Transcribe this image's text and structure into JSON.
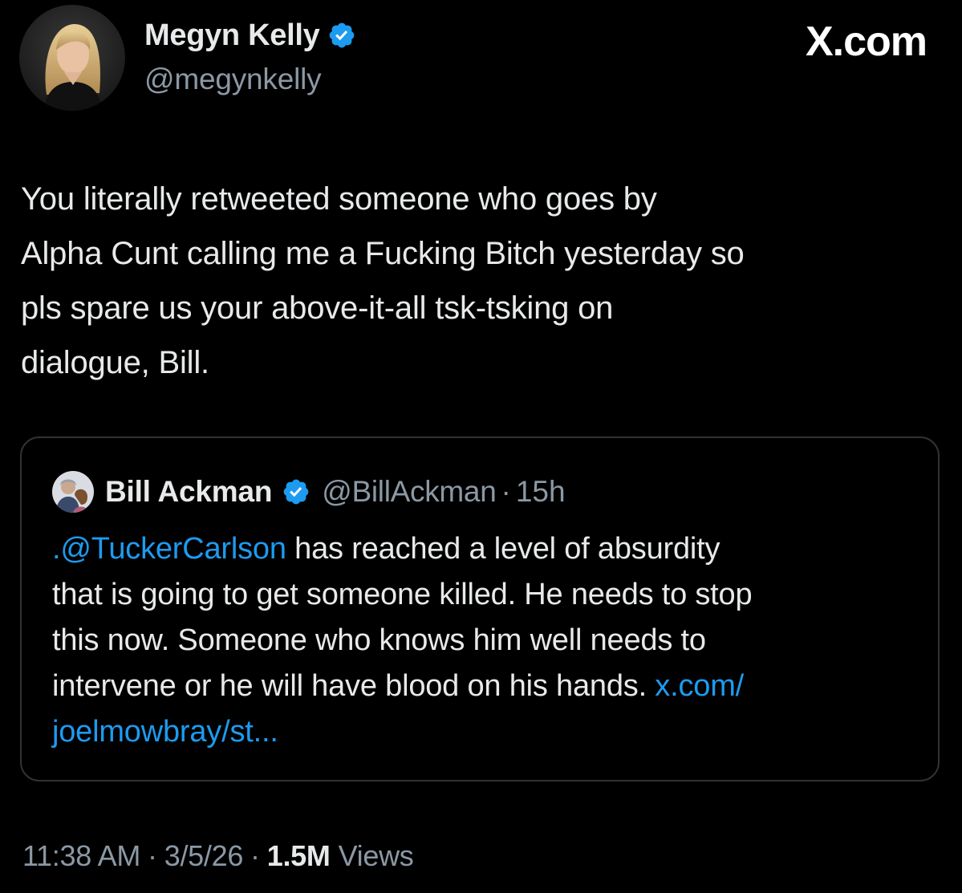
{
  "author": {
    "name": "Megyn Kelly",
    "handle": "@megynkelly",
    "verified_icon": "verified-badge-icon"
  },
  "brand": {
    "label": "X.com"
  },
  "tweet": {
    "lines": [
      "You literally retweeted someone who goes by",
      "Alpha Cunt calling me a Fucking Bitch yesterday so",
      "pls spare us your above-it-all tsk-tsking on",
      "dialogue, Bill."
    ]
  },
  "quote": {
    "name": "Bill Ackman",
    "handle": "@BillAckman",
    "separator": "·",
    "time": "15h",
    "mention": ".@TuckerCarlson",
    "line1_rest": " has reached a level of absurdity",
    "line2": "that is going to get someone killed. He needs to stop",
    "line3": "this now. Someone who knows him well needs to",
    "line4_text": "intervene or he will have blood on his hands. ",
    "link_part1": "x.com/",
    "link_part2": "joelmowbray/st..."
  },
  "meta": {
    "time": "11:38 AM",
    "separator": "·",
    "date": "3/5/26",
    "views_count": "1.5M",
    "views_label": "Views"
  },
  "colors": {
    "background": "#000000",
    "text": "#e7e9ea",
    "secondary": "#8b98a5",
    "link": "#1d9bf0",
    "verified": "#1d9bf0",
    "border": "#2f3336"
  }
}
